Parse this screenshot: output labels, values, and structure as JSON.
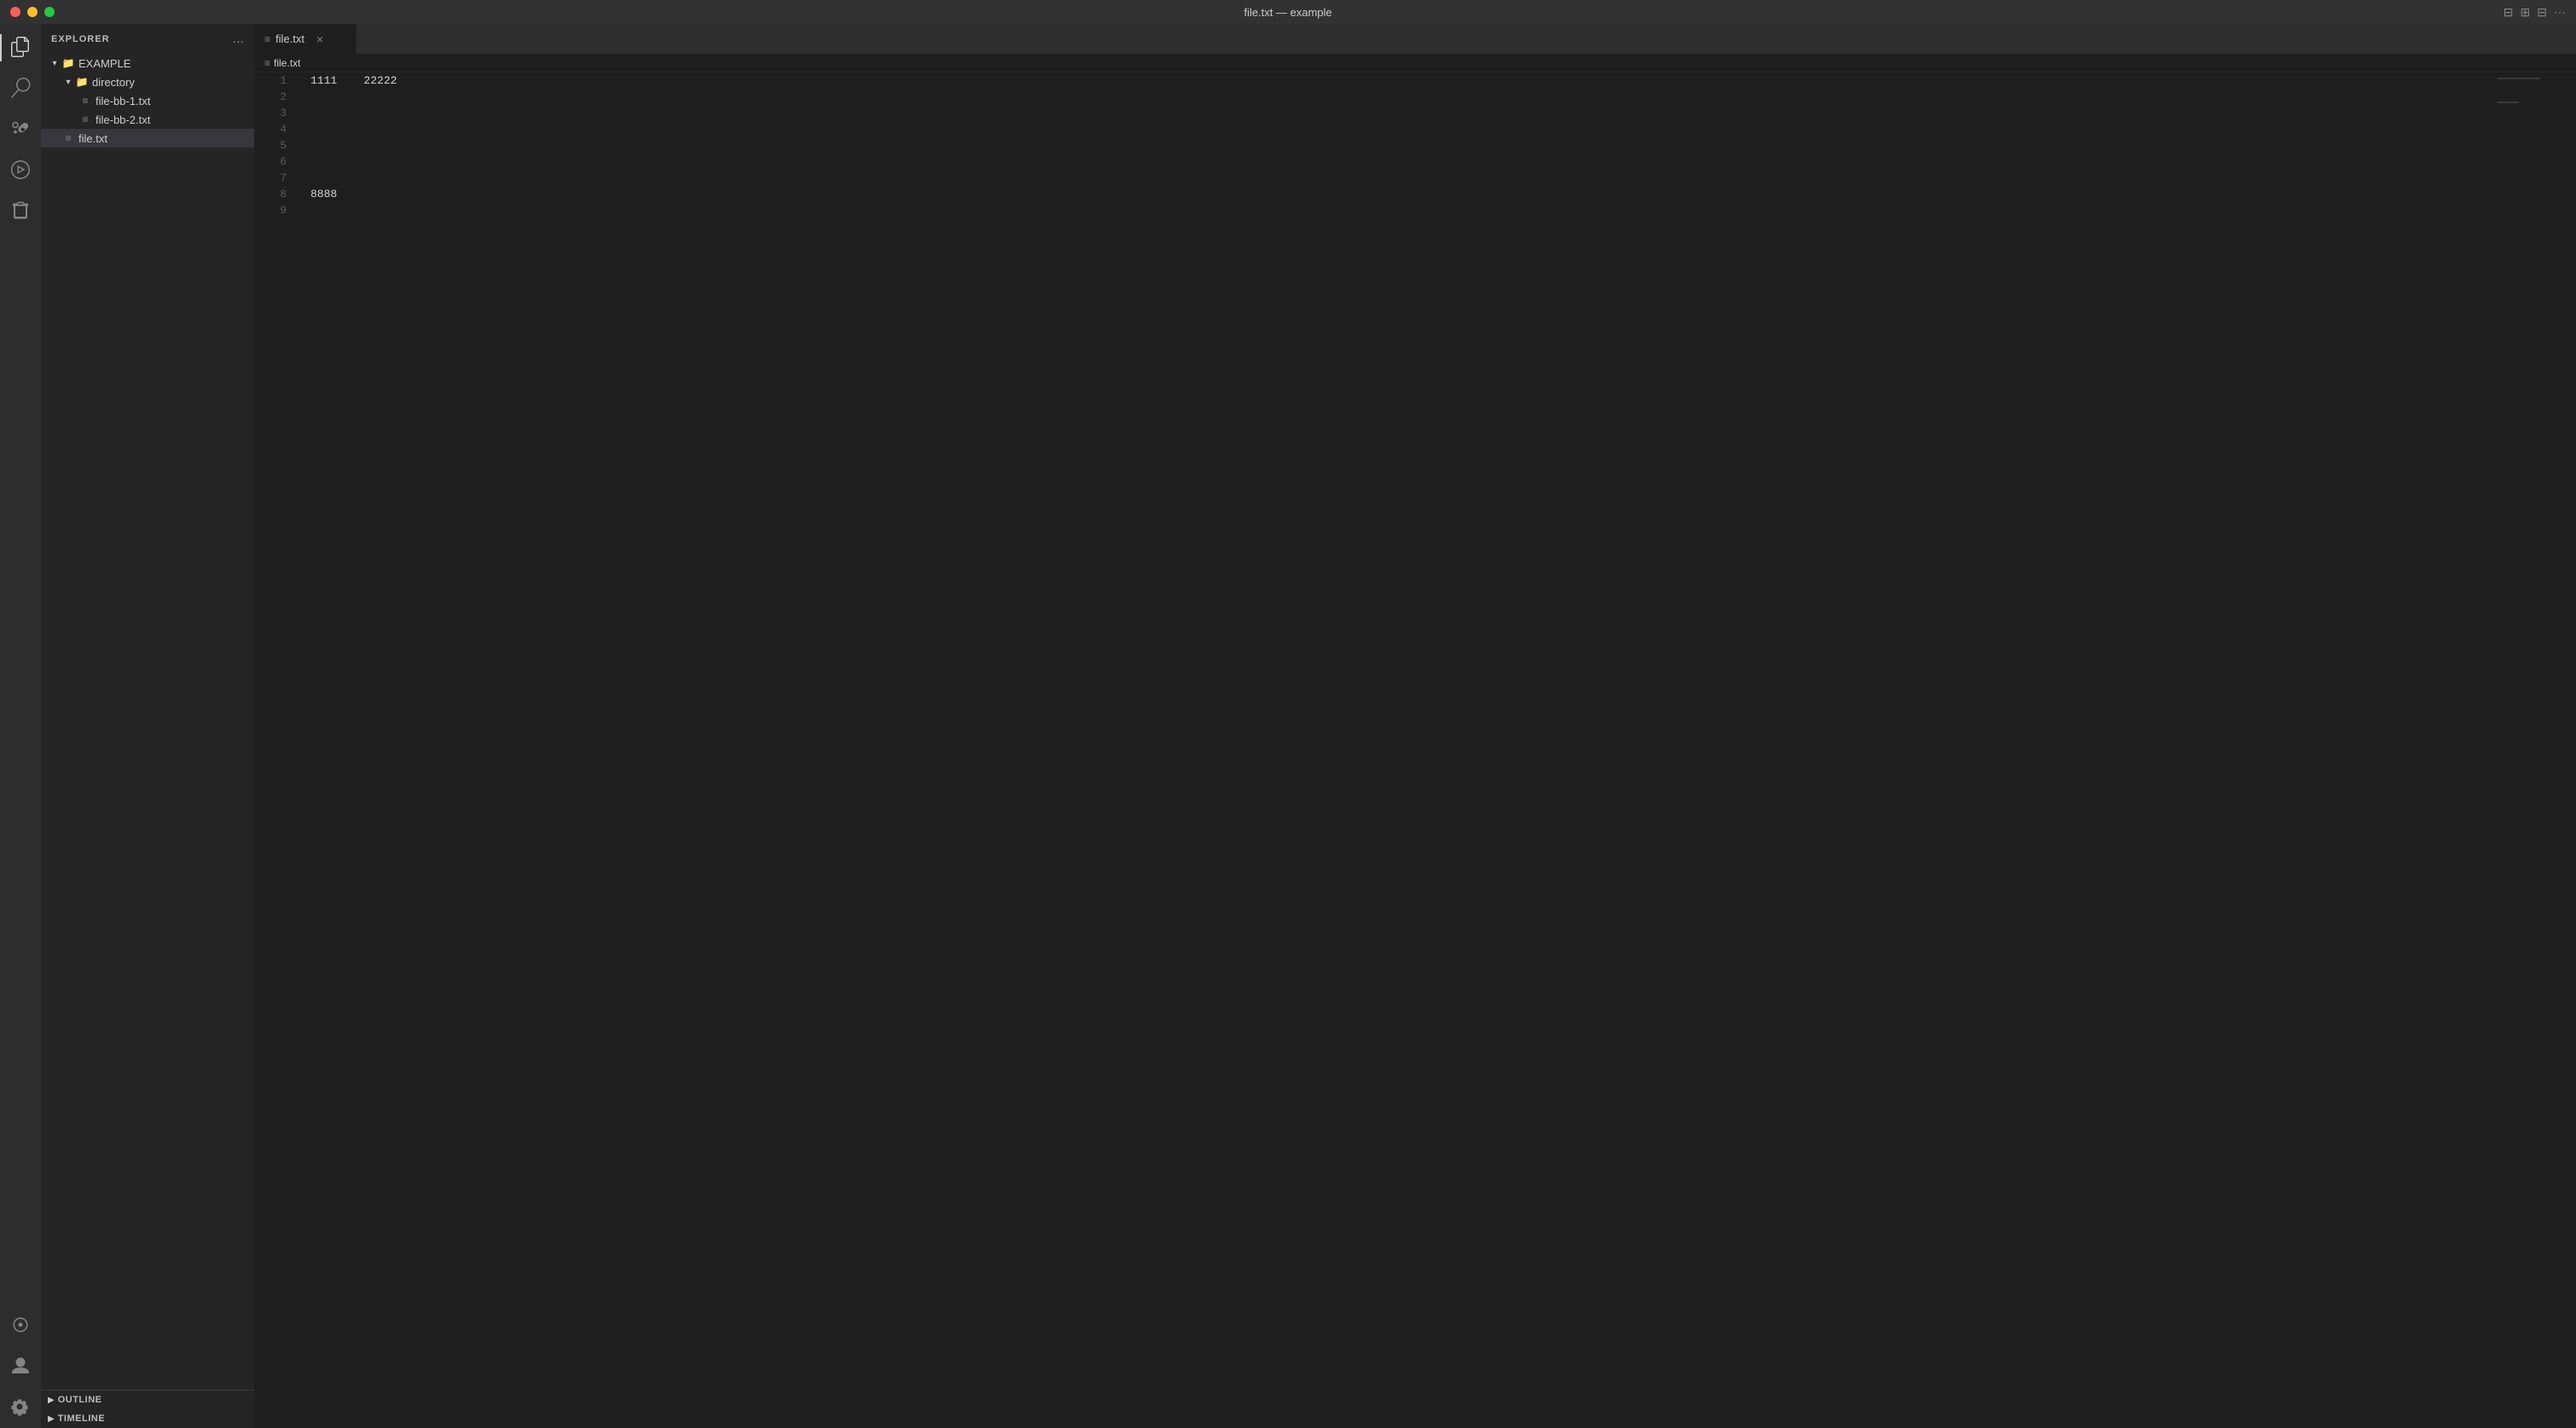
{
  "titlebar": {
    "title": "file.txt — example",
    "traffic": {
      "close": "close",
      "minimize": "minimize",
      "maximize": "maximize"
    }
  },
  "activity_bar": {
    "items": [
      {
        "id": "explorer",
        "label": "Explorer",
        "active": true
      },
      {
        "id": "search",
        "label": "Search",
        "active": false
      },
      {
        "id": "source-control",
        "label": "Source Control",
        "active": false
      },
      {
        "id": "run",
        "label": "Run and Debug",
        "active": false
      },
      {
        "id": "extensions",
        "label": "Extensions",
        "active": false
      },
      {
        "id": "remote",
        "label": "Remote Explorer",
        "active": false
      },
      {
        "id": "testing",
        "label": "Testing",
        "active": false
      }
    ],
    "bottom_items": [
      {
        "id": "accounts",
        "label": "Accounts"
      },
      {
        "id": "settings",
        "label": "Settings"
      }
    ]
  },
  "sidebar": {
    "title": "EXPLORER",
    "more_actions_title": "...",
    "tree": {
      "root": {
        "label": "EXAMPLE",
        "expanded": true,
        "children": [
          {
            "label": "directory",
            "type": "folder",
            "expanded": true,
            "children": [
              {
                "label": "file-bb-1.txt",
                "type": "file"
              },
              {
                "label": "file-bb-2.txt",
                "type": "file"
              }
            ]
          },
          {
            "label": "file.txt",
            "type": "file",
            "selected": true
          }
        ]
      }
    },
    "bottom": {
      "outline": {
        "label": "OUTLINE",
        "expanded": false
      },
      "timeline": {
        "label": "TIMELINE",
        "expanded": false
      }
    }
  },
  "editor": {
    "tab": {
      "label": "file.txt",
      "icon": "file-icon"
    },
    "breadcrumb": {
      "file": "file.txt"
    },
    "lines": [
      {
        "number": 1,
        "content": "1111    22222"
      },
      {
        "number": 2,
        "content": ""
      },
      {
        "number": 3,
        "content": ""
      },
      {
        "number": 4,
        "content": ""
      },
      {
        "number": 5,
        "content": ""
      },
      {
        "number": 6,
        "content": ""
      },
      {
        "number": 7,
        "content": ""
      },
      {
        "number": 8,
        "content": "8888"
      },
      {
        "number": 9,
        "content": ""
      }
    ]
  }
}
